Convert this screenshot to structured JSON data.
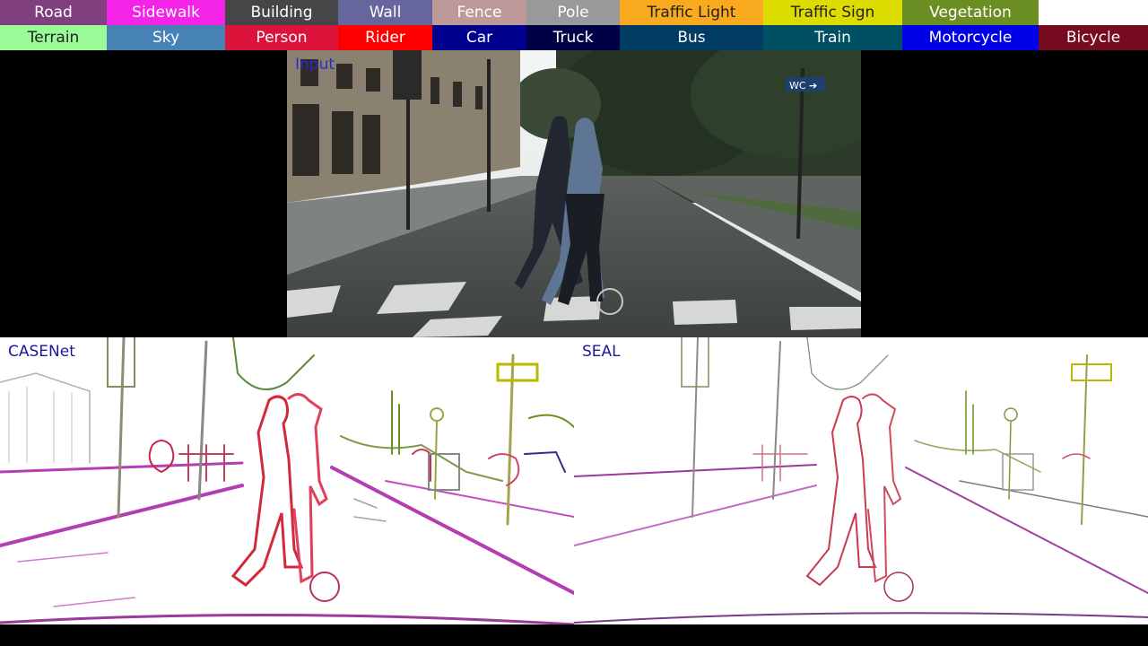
{
  "legend": {
    "row1": [
      {
        "label": "Road",
        "color": "#804080"
      },
      {
        "label": "Sidewalk",
        "color": "#f423e8"
      },
      {
        "label": "Building",
        "color": "#464646"
      },
      {
        "label": "Wall",
        "color": "#66669c"
      },
      {
        "label": "Fence",
        "color": "#be9999"
      },
      {
        "label": "Pole",
        "color": "#999999"
      },
      {
        "label": "Traffic Light",
        "color": "#faaa1e"
      },
      {
        "label": "Traffic Sign",
        "color": "#dcdc00"
      },
      {
        "label": "Vegetation",
        "color": "#6b8e23"
      },
      {
        "label": "",
        "color": "#ffffff"
      }
    ],
    "row2": [
      {
        "label": "Terrain",
        "color": "#98fb98"
      },
      {
        "label": "Sky",
        "color": "#4682b4"
      },
      {
        "label": "Person",
        "color": "#dc143c"
      },
      {
        "label": "Rider",
        "color": "#ff0000"
      },
      {
        "label": "Car",
        "color": "#00008e"
      },
      {
        "label": "Truck",
        "color": "#000046"
      },
      {
        "label": "Bus",
        "color": "#003c64"
      },
      {
        "label": "Train",
        "color": "#005064"
      },
      {
        "label": "Motorcycle",
        "color": "#0000e6"
      },
      {
        "label": "Bicycle",
        "color": "#770b20"
      }
    ]
  },
  "panels": {
    "input_label": "Input",
    "casenet_label": "CASENet",
    "seal_label": "SEAL",
    "sign_text": "WC ➔"
  }
}
